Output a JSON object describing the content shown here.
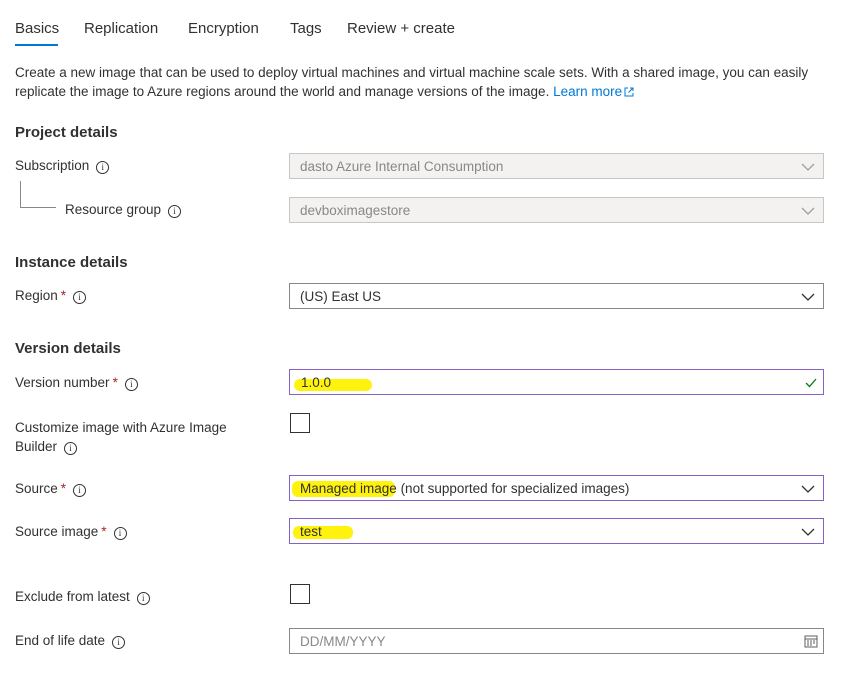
{
  "tabs": [
    {
      "label": "Basics",
      "active": true
    },
    {
      "label": "Replication"
    },
    {
      "label": "Encryption"
    },
    {
      "label": "Tags"
    },
    {
      "label": "Review + create"
    }
  ],
  "description": {
    "text": "Create a new image that can be used to deploy virtual machines and virtual machine scale sets. With a shared image, you can easily replicate the image to Azure regions around the world and manage versions of the image.",
    "link": "Learn more"
  },
  "project_details": {
    "header": "Project details",
    "subscription": {
      "label": "Subscription",
      "value": "dasto Azure Internal Consumption"
    },
    "resource_group": {
      "label": "Resource group",
      "value": "devboximagestore"
    }
  },
  "instance_details": {
    "header": "Instance details",
    "region": {
      "label": "Region",
      "value": "(US) East US"
    }
  },
  "version_details": {
    "header": "Version details",
    "version_number": {
      "label": "Version number",
      "value": "1.0.0"
    },
    "customize": {
      "label_line1": "Customize image with Azure Image",
      "label_line2": "Builder"
    },
    "source": {
      "label": "Source",
      "value": "Managed image (not supported for specialized images)"
    },
    "source_image": {
      "label": "Source image",
      "value": "test"
    },
    "exclude_latest": {
      "label": "Exclude from latest"
    },
    "end_of_life": {
      "label": "End of life date",
      "placeholder": "DD/MM/YYYY"
    }
  },
  "required_marker": "*",
  "colors": {
    "accent": "#0078d4",
    "highlight": "#fff100",
    "valid": "#107c10",
    "required": "#a4262c"
  }
}
